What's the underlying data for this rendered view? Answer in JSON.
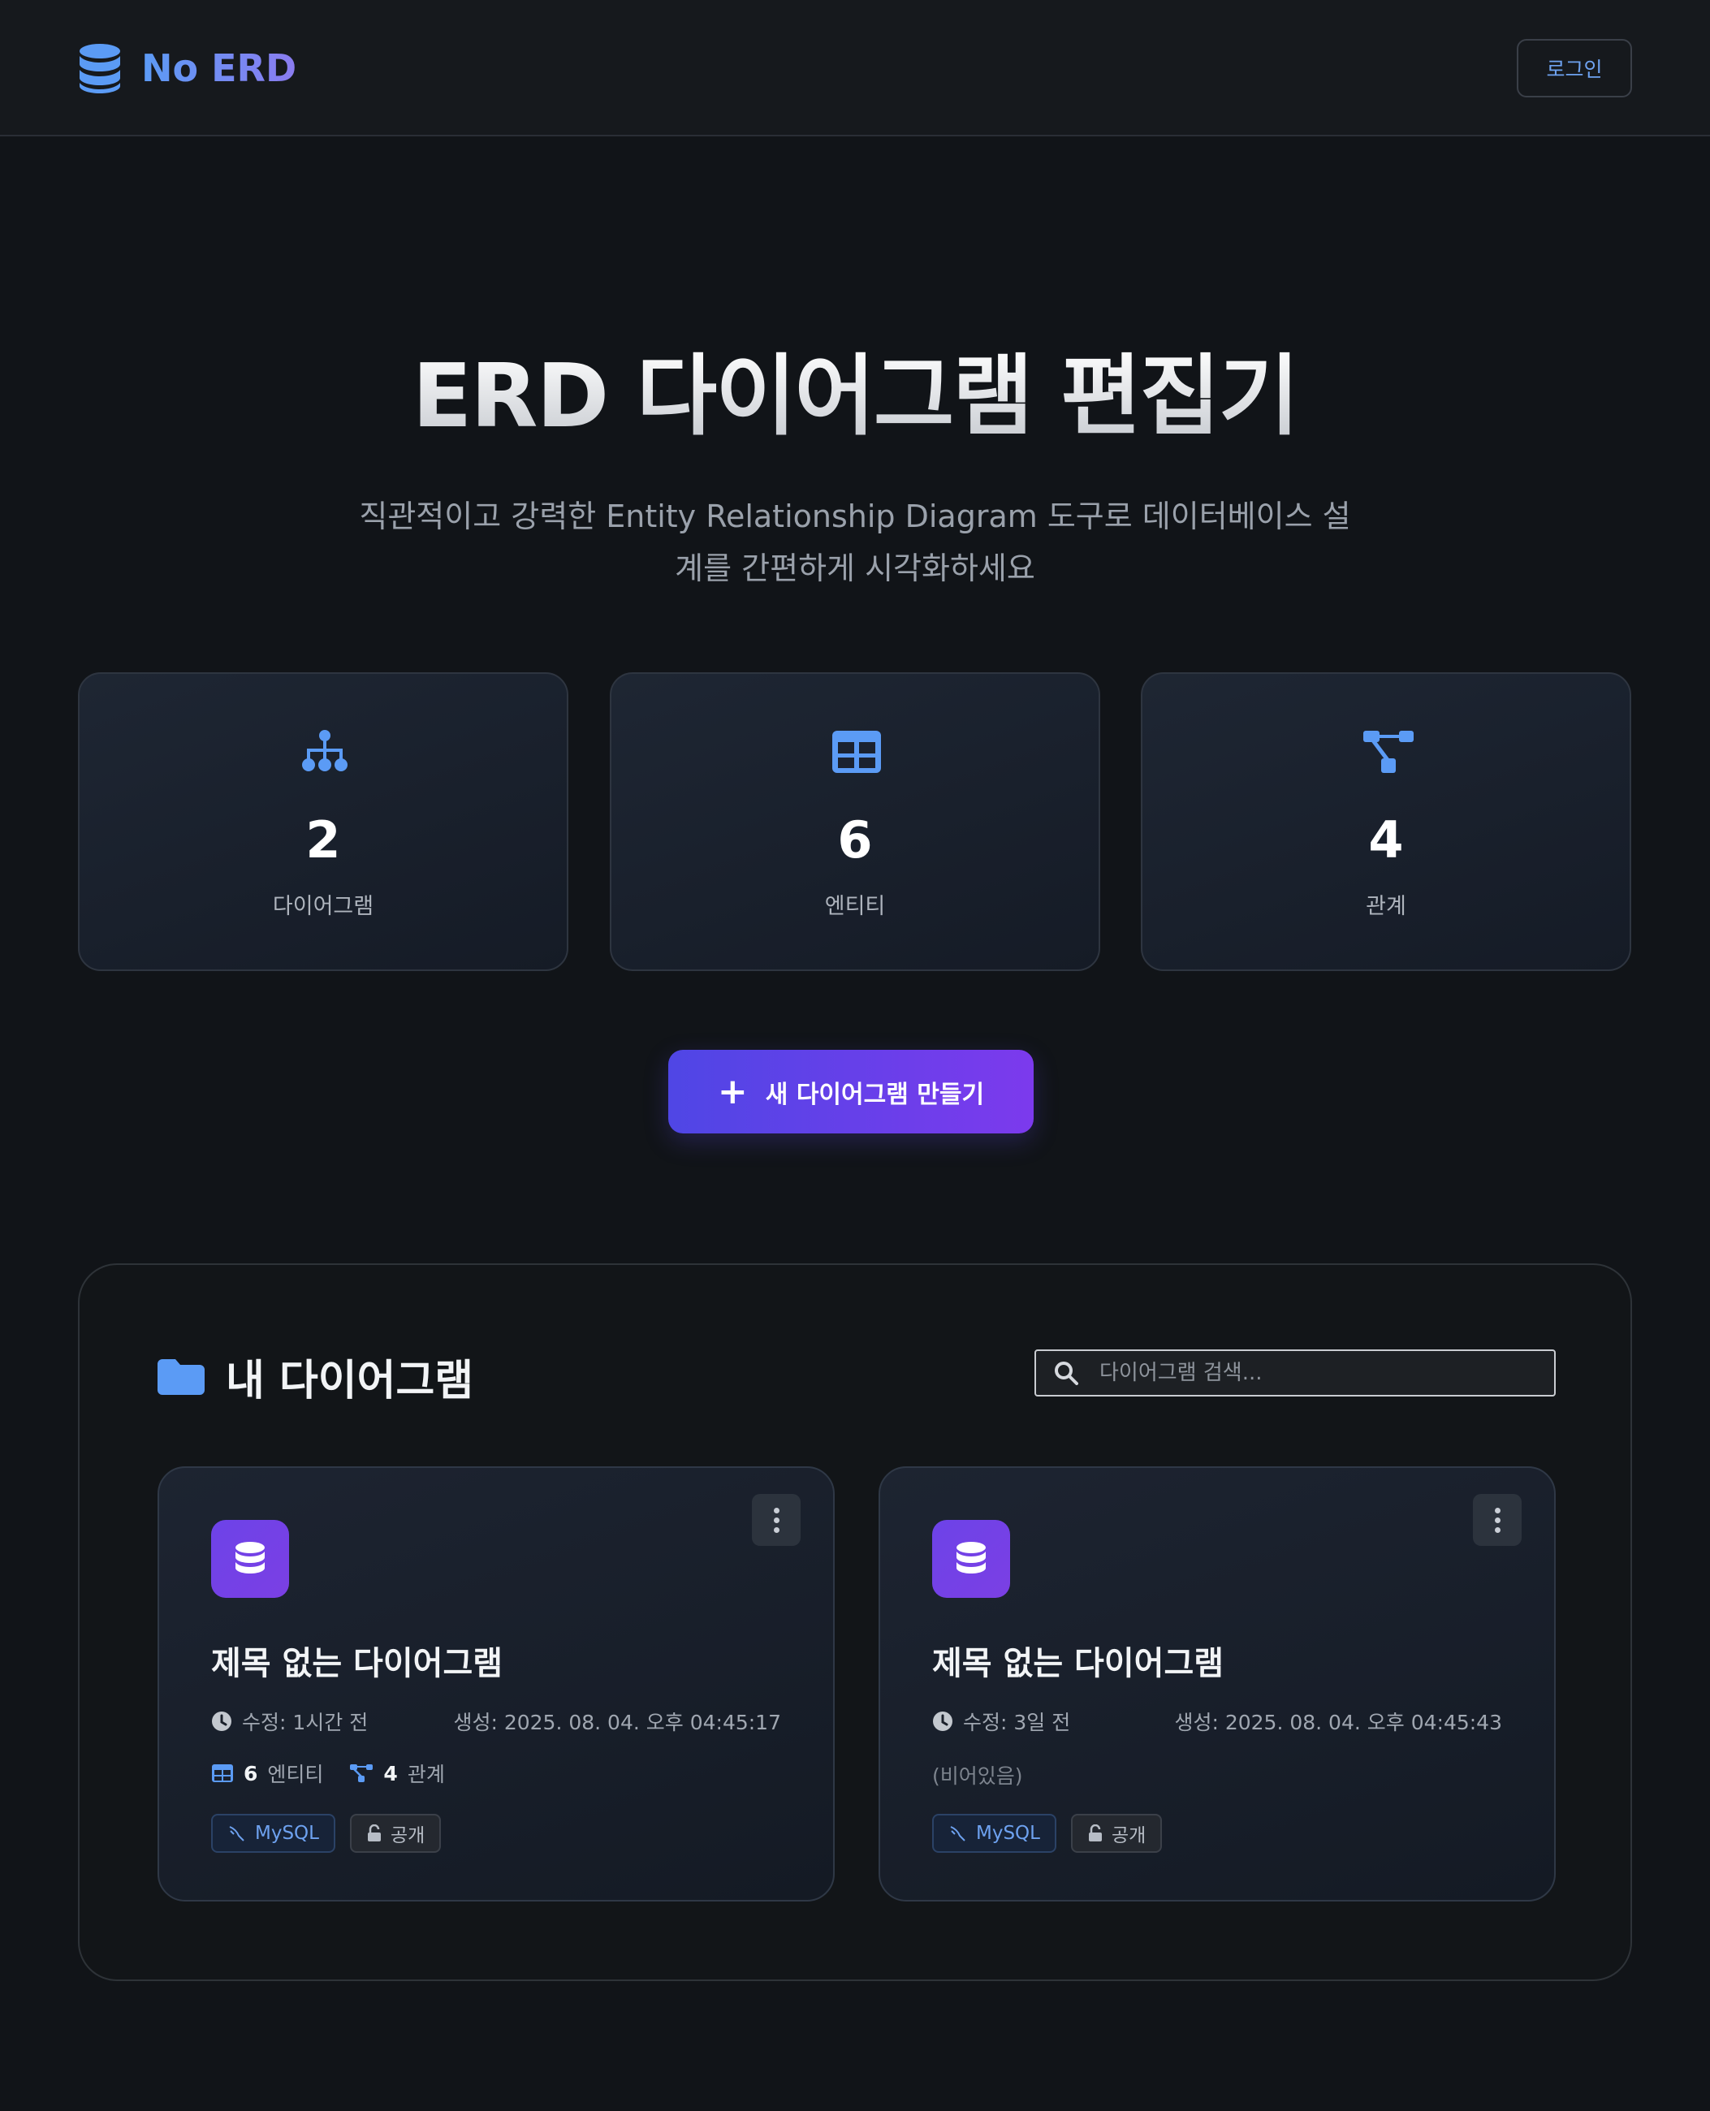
{
  "header": {
    "app_name": "No ERD",
    "login_label": "로그인"
  },
  "hero": {
    "title": "ERD 다이어그램 편집기",
    "subtitle": "직관적이고 강력한 Entity Relationship Diagram 도구로 데이터베이스 설계를 간편하게 시각화하세요"
  },
  "stats": [
    {
      "value": "2",
      "label": "다이어그램",
      "icon": "sitemap-icon"
    },
    {
      "value": "6",
      "label": "엔티티",
      "icon": "table-icon"
    },
    {
      "value": "4",
      "label": "관계",
      "icon": "relation-icon"
    }
  ],
  "new_button_label": "새 다이어그램 만들기",
  "section": {
    "title": "내 다이어그램",
    "search_placeholder": "다이어그램 검색..."
  },
  "diagrams": [
    {
      "title": "제목 없는 다이어그램",
      "modified": "수정: 1시간 전",
      "created": "생성: 2025. 08. 04. 오후 04:45:17",
      "entity_count": "6",
      "entity_label": "엔티티",
      "relation_count": "4",
      "relation_label": "관계",
      "db_tag": "MySQL",
      "visibility_tag": "공개"
    },
    {
      "title": "제목 없는 다이어그램",
      "modified": "수정: 3일 전",
      "created": "생성: 2025. 08. 04. 오후 04:45:43",
      "empty_label": "(비어있음)",
      "db_tag": "MySQL",
      "visibility_tag": "공개"
    }
  ],
  "colors": {
    "background": "#111418",
    "accent_blue": "#5b9bf5",
    "accent_purple": "#7c3aed",
    "primary_gradient_start": "#4f46e5"
  }
}
